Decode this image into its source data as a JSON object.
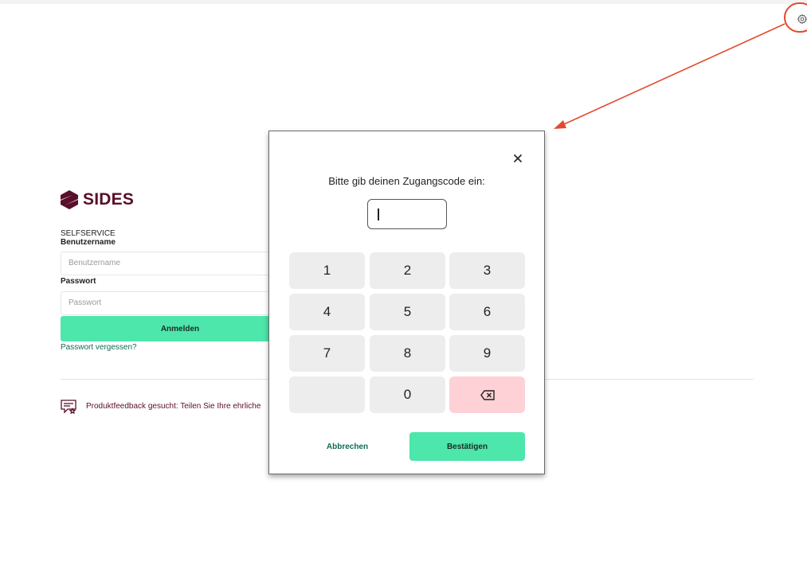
{
  "header": {
    "settings_icon": "gear-icon"
  },
  "brand": {
    "name": "SIDES",
    "color": "#5a0f2a"
  },
  "login": {
    "section_label": "SELFSERVICE",
    "username_label": "Benutzername",
    "username_placeholder": "Benutzername",
    "password_label": "Passwort",
    "password_placeholder": "Passwort",
    "login_button": "Anmelden",
    "forgot_link": "Passwort vergessen?"
  },
  "feedback": {
    "text": "Produktfeedback gesucht: Teilen Sie Ihre ehrliche"
  },
  "modal": {
    "prompt": "Bitte gib deinen Zugangscode ein:",
    "code_value": "",
    "keys": [
      "1",
      "2",
      "3",
      "4",
      "5",
      "6",
      "7",
      "8",
      "9",
      "",
      "0",
      "backspace"
    ],
    "cancel_button": "Abbrechen",
    "confirm_button": "Bestätigen"
  },
  "colors": {
    "accent": "#4de6ab",
    "delete_key": "#fdd1d5",
    "link": "#0f6b57",
    "annotation": "#e24a2e"
  }
}
